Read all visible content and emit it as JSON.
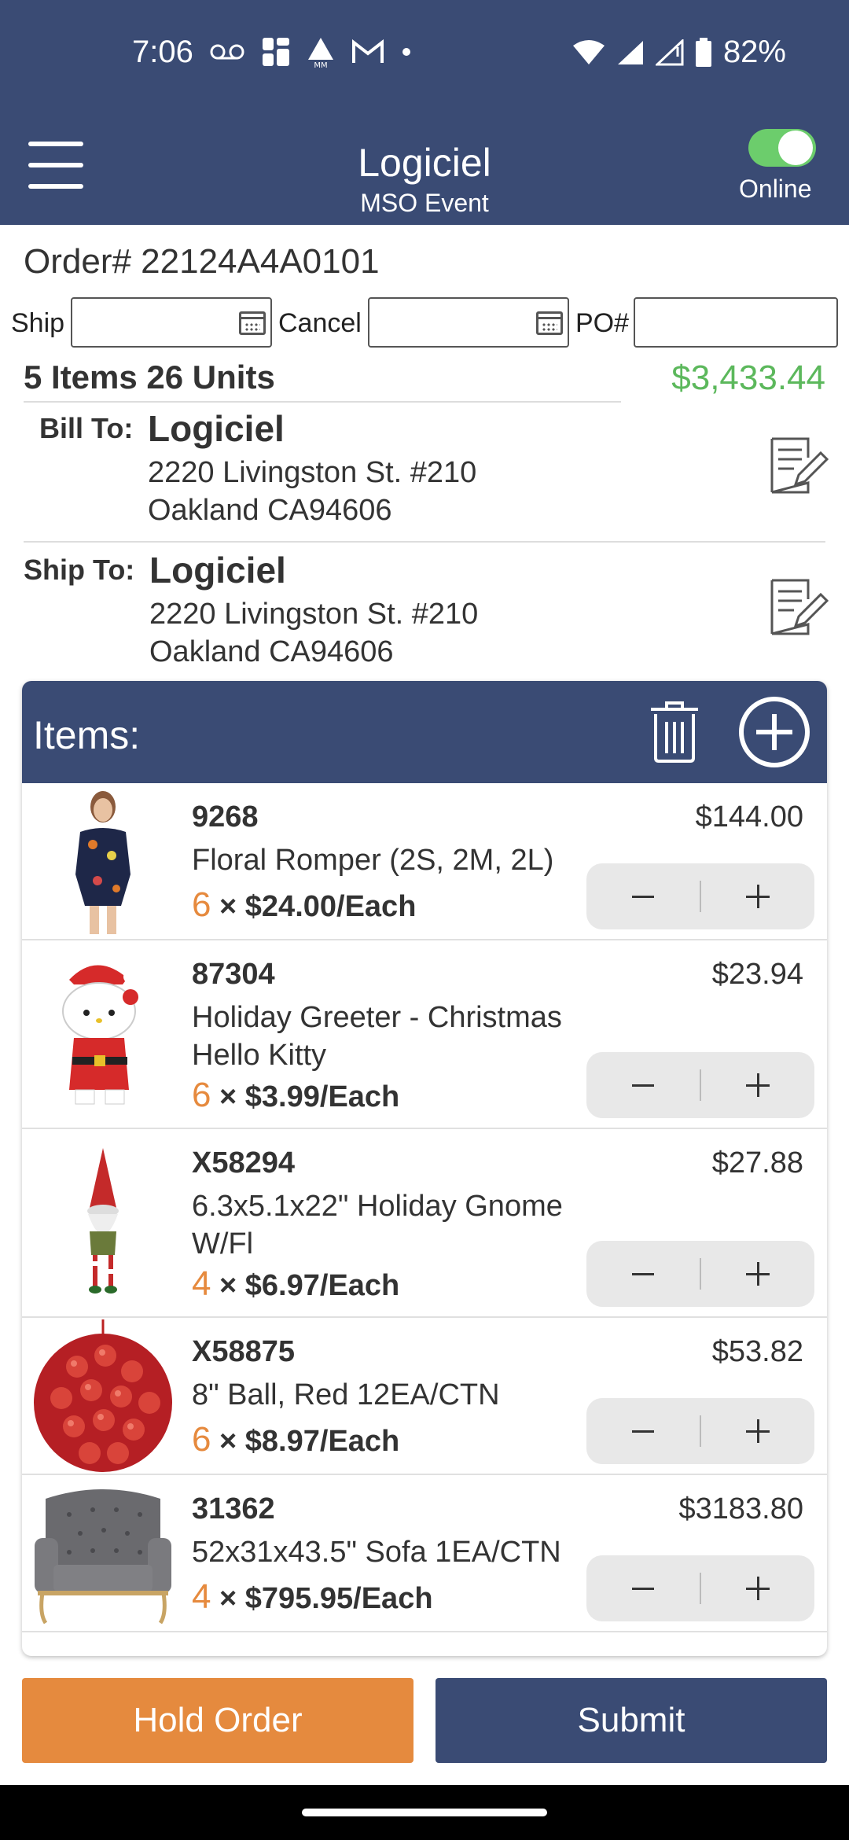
{
  "status_bar": {
    "time": "7:06",
    "battery": "82%"
  },
  "app_bar": {
    "title": "Logiciel",
    "subtitle": "MSO Event",
    "online_label": "Online"
  },
  "order": {
    "number": "Order# 22124A4A0101",
    "ship_label": "Ship",
    "cancel_label": "Cancel",
    "po_label": "PO#",
    "summary": "5 Items 26 Units",
    "total": "$3,433.44"
  },
  "bill_to": {
    "label": "Bill To:",
    "name": "Logiciel",
    "line1": "2220 Livingston St. #210",
    "line2": "Oakland  CA94606"
  },
  "ship_to": {
    "label": "Ship To:",
    "name": "Logiciel",
    "line1": "2220 Livingston St. #210",
    "line2": "Oakland  CA94606"
  },
  "items_header": "Items:",
  "items": [
    {
      "sku": "9268",
      "desc": "Floral Romper (2S, 2M, 2L)",
      "qty": "6",
      "price": " × $24.00/Each",
      "total": "$144.00"
    },
    {
      "sku": "87304",
      "desc": "Holiday Greeter - Christmas Hello Kitty",
      "qty": "6",
      "price": " × $3.99/Each",
      "total": "$23.94"
    },
    {
      "sku": "X58294",
      "desc": "6.3x5.1x22\" Holiday Gnome W/Fl",
      "qty": "4",
      "price": " × $6.97/Each",
      "total": "$27.88"
    },
    {
      "sku": "X58875",
      "desc": "8\" Ball, Red 12EA/CTN",
      "qty": "6",
      "price": " × $8.97/Each",
      "total": "$53.82"
    },
    {
      "sku": "31362",
      "desc": "52x31x43.5\" Sofa 1EA/CTN",
      "qty": "4",
      "price": " × $795.95/Each",
      "total": "$3183.80"
    }
  ],
  "buttons": {
    "hold": "Hold Order",
    "submit": "Submit"
  },
  "colors": {
    "header": "#3a4b74",
    "accent_orange": "#e58a3e",
    "total_green": "#5cb85c"
  }
}
